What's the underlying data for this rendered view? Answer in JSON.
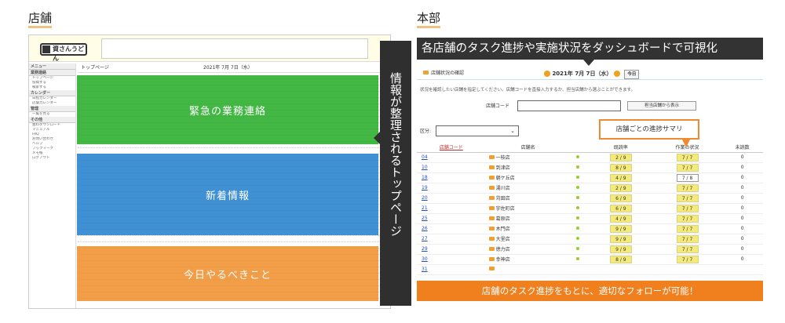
{
  "left": {
    "section_title": "店舗",
    "logo_text": "資さんうどん",
    "topbar_title": "トップページ",
    "topbar_date": "2021年 7月 7日（水）",
    "sidebar": {
      "header": "メニュー",
      "groups": [
        {
          "title": "業務連絡",
          "items": [
            "トップページ",
            "投稿する",
            "検索する"
          ]
        },
        {
          "title": "カレンダー",
          "items": [
            "日程カレンダー",
            "店舗カレンダー"
          ]
        },
        {
          "title": "管理",
          "items": [
            "一覧を見る"
          ]
        },
        {
          "title": "その他",
          "items": [
            "資料ダウンロード",
            "マニュアル",
            "FAQ",
            "お問い合わせ",
            "ヘルプ",
            "ブックマーク",
            "メモ帳",
            "ログアウト"
          ]
        }
      ]
    },
    "overlays": {
      "urgent": "緊急の業務連絡",
      "news": "新着情報",
      "todo": "今日やるべきこと"
    },
    "vertical_caption": "情報が整理されるトップページ"
  },
  "right": {
    "section_title": "本部",
    "banner": "各店舗のタスク進捗や実施状況をダッシュボードで可視化",
    "header_title": "店舗状況の確認",
    "date": "2021年 7月 7日（水）",
    "today_btn": "今日",
    "description": "状況を確認したい店舗を指定してください。店舗コードを直接入力するか、担当店舗から選ぶことができます。",
    "code_label": "店舗コード",
    "code_value": "",
    "code_btn": "担当店舗から表示",
    "kubun_label": "区分:",
    "kubun_value": "",
    "callout": "店舗ごとの進捗サマリ",
    "footer_banner": "店舗のタスク進捗をもとに、適切なフォローが可能！",
    "table": {
      "headers": [
        "店舗コード",
        "店舗名",
        "",
        "既読率",
        "作業の状況",
        "未読数"
      ],
      "rows": [
        {
          "code": "04",
          "name": "一枝店",
          "read": "2 / 9",
          "work": "7 / 7",
          "unread": "0"
        },
        {
          "code": "10",
          "name": "到津店",
          "read": "8 / 9",
          "work": "7 / 7",
          "unread": "0"
        },
        {
          "code": "18",
          "name": "朝ケ丘店",
          "read": "4 / 9",
          "work": "7 / 8",
          "unread": "0"
        },
        {
          "code": "19",
          "name": "湯川店",
          "read": "2 / 9",
          "work": "7 / 7",
          "unread": "0"
        },
        {
          "code": "20",
          "name": "苅田店",
          "read": "6 / 9",
          "work": "7 / 7",
          "unread": "0"
        },
        {
          "code": "21",
          "name": "宇佐町店",
          "read": "6 / 9",
          "work": "7 / 7",
          "unread": "0"
        },
        {
          "code": "25",
          "name": "葛原店",
          "read": "4 / 9",
          "work": "7 / 7",
          "unread": "0"
        },
        {
          "code": "26",
          "name": "木門店",
          "read": "9 / 9",
          "work": "7 / 7",
          "unread": "0"
        },
        {
          "code": "27",
          "name": "大里店",
          "read": "9 / 9",
          "work": "7 / 7",
          "unread": "0"
        },
        {
          "code": "29",
          "name": "徳力店",
          "read": "9 / 9",
          "work": "7 / 7",
          "unread": "0"
        },
        {
          "code": "30",
          "name": "幸神店",
          "read": "8 / 9",
          "work": "7 / 7",
          "unread": "0"
        },
        {
          "code": "31",
          "name": "",
          "read": "",
          "work": "",
          "unread": ""
        }
      ]
    }
  }
}
